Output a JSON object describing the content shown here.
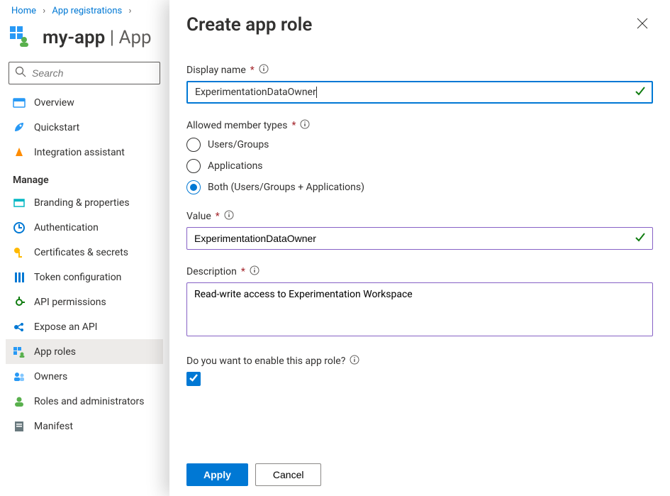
{
  "breadcrumb": {
    "home": "Home",
    "appRegs": "App registrations"
  },
  "header": {
    "appName": "my-app",
    "suffix": " | App"
  },
  "sidebar": {
    "searchPlaceholder": "Search",
    "top": [
      {
        "label": "Overview"
      },
      {
        "label": "Quickstart"
      },
      {
        "label": "Integration assistant"
      }
    ],
    "manageHeader": "Manage",
    "manage": [
      {
        "label": "Branding & properties"
      },
      {
        "label": "Authentication"
      },
      {
        "label": "Certificates & secrets"
      },
      {
        "label": "Token configuration"
      },
      {
        "label": "API permissions"
      },
      {
        "label": "Expose an API"
      },
      {
        "label": "App roles"
      },
      {
        "label": "Owners"
      },
      {
        "label": "Roles and administrators"
      },
      {
        "label": "Manifest"
      }
    ],
    "selectedIndex": 6
  },
  "flyout": {
    "title": "Create app role",
    "displayName": {
      "label": "Display name",
      "value": "ExperimentationDataOwner"
    },
    "memberTypes": {
      "label": "Allowed member types",
      "options": [
        "Users/Groups",
        "Applications",
        "Both (Users/Groups + Applications)"
      ],
      "selected": 2
    },
    "value": {
      "label": "Value",
      "value": "ExperimentationDataOwner"
    },
    "description": {
      "label": "Description",
      "value": "Read-write access to Experimentation Workspace"
    },
    "enable": {
      "label": "Do you want to enable this app role?",
      "checked": true
    },
    "buttons": {
      "apply": "Apply",
      "cancel": "Cancel"
    }
  }
}
